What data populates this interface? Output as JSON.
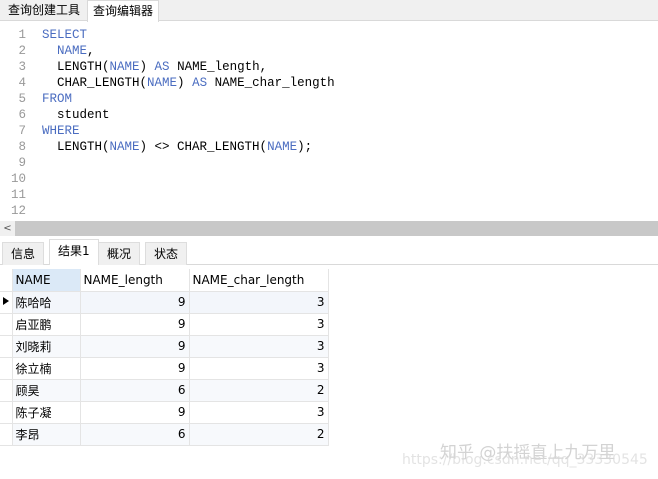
{
  "tabs": [
    "查询创建工具",
    "查询编辑器"
  ],
  "code": [
    {
      "n": "1",
      "parts": [
        [
          "kw",
          "SELECT"
        ]
      ]
    },
    {
      "n": "2",
      "parts": [
        [
          "",
          "  "
        ],
        [
          "kw",
          "NAME"
        ],
        [
          "",
          ","
        ]
      ]
    },
    {
      "n": "3",
      "parts": [
        [
          "",
          "  LENGTH("
        ],
        [
          "kw",
          "NAME"
        ],
        [
          "",
          ") "
        ],
        [
          "kw",
          "AS"
        ],
        [
          "",
          "",
          " NAME_length,"
        ]
      ]
    },
    {
      "n": "4",
      "parts": [
        [
          "",
          "  CHAR_LENGTH("
        ],
        [
          "kw",
          "NAME"
        ],
        [
          "",
          ") "
        ],
        [
          "kw",
          "AS"
        ],
        [
          "",
          " NAME_char_length"
        ]
      ]
    },
    {
      "n": "5",
      "parts": [
        [
          "kw",
          "FROM"
        ]
      ]
    },
    {
      "n": "6",
      "parts": [
        [
          "",
          "  student"
        ]
      ]
    },
    {
      "n": "7",
      "parts": [
        [
          "kw",
          "WHERE"
        ]
      ]
    },
    {
      "n": "8",
      "parts": [
        [
          "",
          "  LENGTH("
        ],
        [
          "kw",
          "NAME"
        ],
        [
          "",
          ") <> CHAR_LENGTH("
        ],
        [
          "kw",
          "NAME"
        ],
        [
          "",
          ");"
        ]
      ]
    },
    {
      "n": "9",
      "parts": []
    },
    {
      "n": "10",
      "parts": []
    },
    {
      "n": "11",
      "parts": []
    },
    {
      "n": "12",
      "parts": []
    }
  ],
  "result_tabs": [
    "信息",
    "结果1",
    "概况",
    "状态"
  ],
  "columns": [
    "NAME",
    "NAME_length",
    "NAME_char_length"
  ],
  "rows": [
    [
      "陈哈哈",
      "9",
      "3"
    ],
    [
      "启亚鹏",
      "9",
      "3"
    ],
    [
      "刘晓莉",
      "9",
      "3"
    ],
    [
      "徐立楠",
      "9",
      "3"
    ],
    [
      "顾昊",
      "6",
      "2"
    ],
    [
      "陈子凝",
      "9",
      "3"
    ],
    [
      "李昂",
      "6",
      "2"
    ]
  ],
  "watermark": {
    "zhihu": "知乎 @扶摇直上九万里",
    "csdn": "https://blog.csdn.net/qq_33330545"
  }
}
